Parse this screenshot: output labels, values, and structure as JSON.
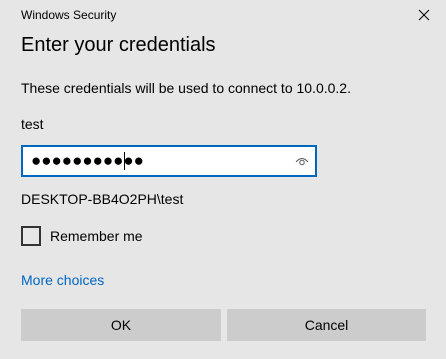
{
  "window": {
    "title": "Windows Security"
  },
  "dialog": {
    "heading": "Enter your credentials",
    "description": "These credentials will be used to connect to 10.0.0.2.",
    "username": "test",
    "password": {
      "masked_value": "●●●●●●●●●●●"
    },
    "domain_user": "DESKTOP-BB4O2PH\\test",
    "remember_me": {
      "label": "Remember me",
      "checked": false
    },
    "more_choices_label": "More choices",
    "ok_label": "OK",
    "cancel_label": "Cancel"
  },
  "icons": {
    "close": "close-icon",
    "reveal_password": "eye-icon"
  },
  "colors": {
    "background": "#e6e6e6",
    "accent": "#0067c0",
    "button": "#cccccc"
  }
}
